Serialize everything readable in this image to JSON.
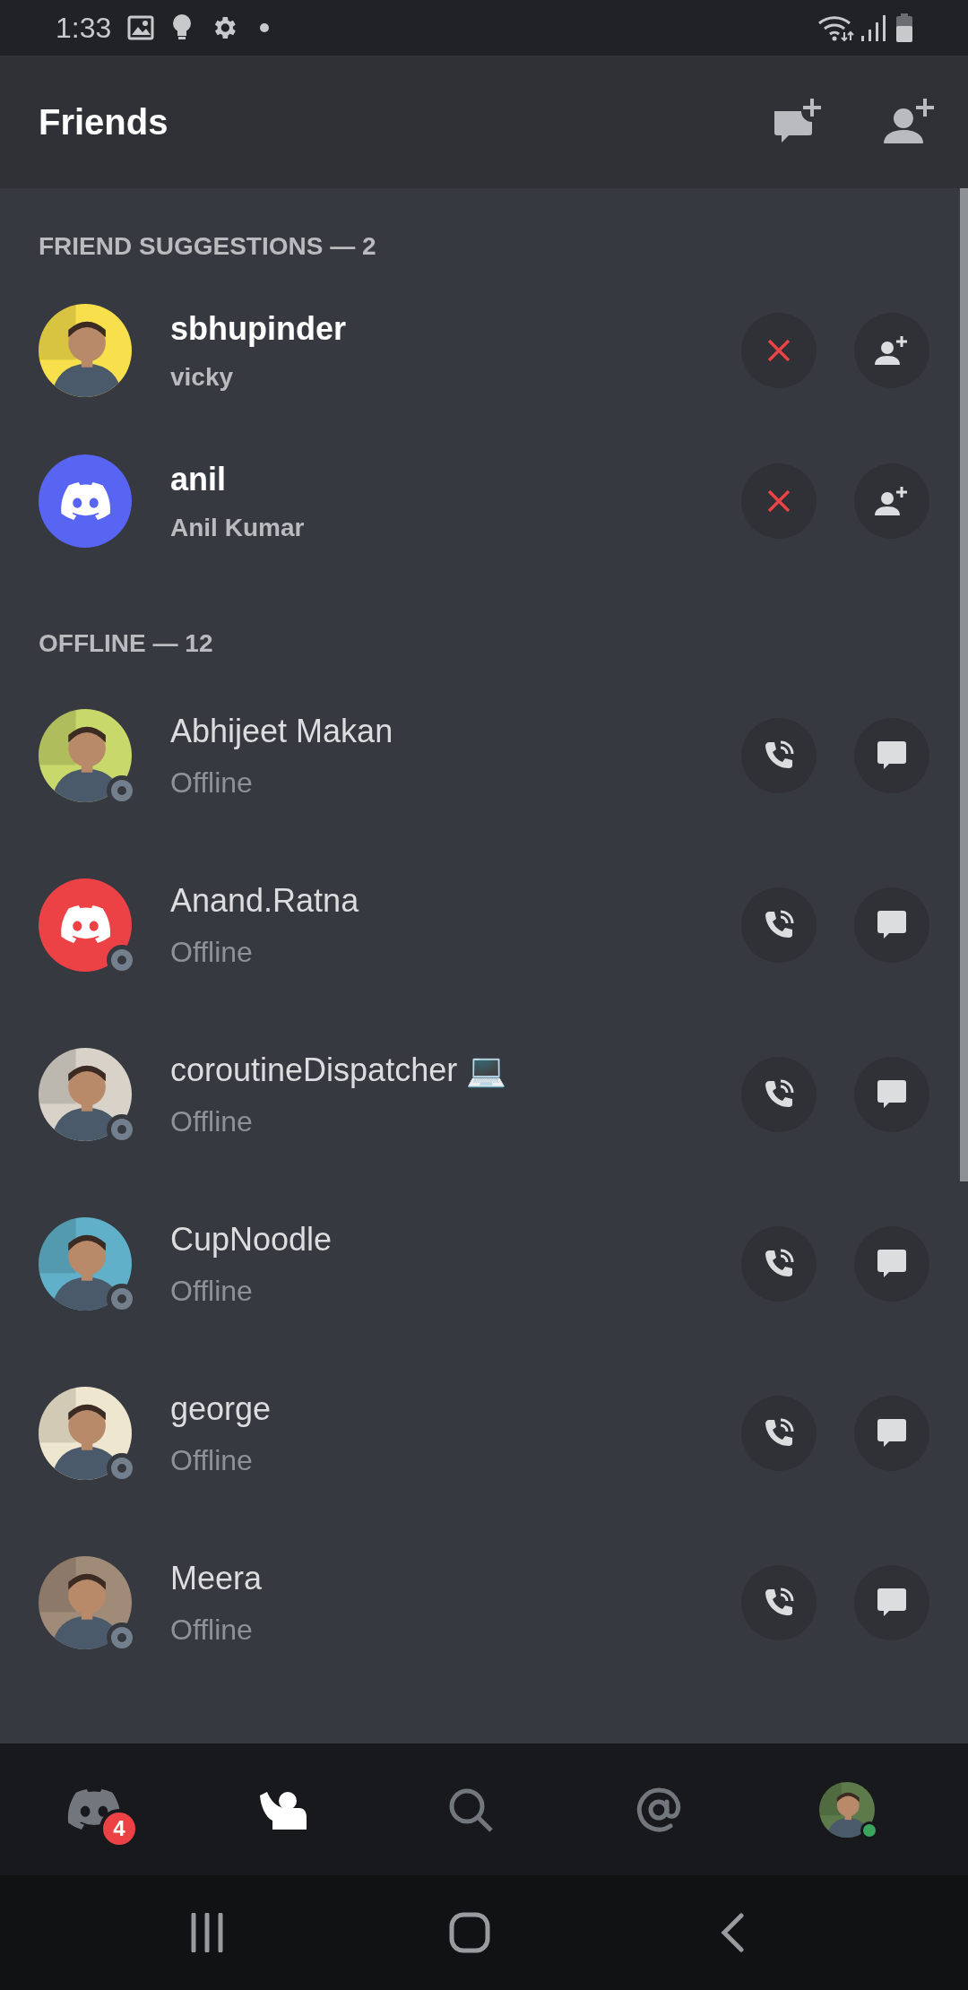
{
  "status_bar": {
    "time": "1:33"
  },
  "header": {
    "title": "Friends"
  },
  "sections": [
    {
      "heading": "FRIEND SUGGESTIONS — 2",
      "kind": "suggestion",
      "rows": [
        {
          "name": "sbhupinder",
          "subtitle": "vicky"
        },
        {
          "name": "anil",
          "subtitle": "Anil Kumar",
          "avatar": {
            "kind": "logo",
            "color": "#5865f2"
          }
        }
      ]
    },
    {
      "heading": "OFFLINE — 12",
      "kind": "friend",
      "rows": [
        {
          "name": "Abhijeet Makan",
          "subtitle": "Offline",
          "online": false
        },
        {
          "name": "Anand.Ratna",
          "subtitle": "Offline",
          "online": false,
          "avatar": {
            "kind": "logo",
            "color": "#ed4245"
          }
        },
        {
          "name": "coroutineDispatcher 💻",
          "subtitle": "Offline",
          "online": false
        },
        {
          "name": "CupNoodle",
          "subtitle": "Offline",
          "online": false
        },
        {
          "name": "george",
          "subtitle": "Offline",
          "online": false
        },
        {
          "name": "Meera",
          "subtitle": "Offline",
          "online": false
        }
      ]
    }
  ],
  "tabs": [
    {
      "kind": "home",
      "selected": false,
      "badge": "4"
    },
    {
      "kind": "friends",
      "selected": true
    },
    {
      "kind": "search",
      "selected": false
    },
    {
      "kind": "mentions",
      "selected": false
    },
    {
      "kind": "profile",
      "selected": false,
      "online": true
    }
  ]
}
